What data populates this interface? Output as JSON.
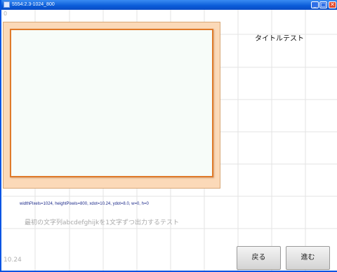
{
  "window": {
    "title": "5554:2.3-1024_800",
    "icon": "emulator-icon",
    "controls": {
      "minimize": "_",
      "maximize": "□",
      "close": "✕"
    }
  },
  "colors": {
    "titlebar": "#0a5bd8",
    "frame_fill": "#fbd9b8",
    "frame_border": "#e07a2a",
    "canvas": "#f7fcf9",
    "grid": "#e3e3e3"
  },
  "screen": {
    "corner_top": "0",
    "corner_bottom": "10.24",
    "title_label": "タイトルテスト",
    "debug_line": "widthPixels=1024, heightPixels=800, xdot=10.24, ydot=8.0, w=0, h=0",
    "message": "最初の文字列abcdefghijkを1文字ずつ出力するテスト"
  },
  "buttons": {
    "back": "戻る",
    "forward": "進む"
  }
}
